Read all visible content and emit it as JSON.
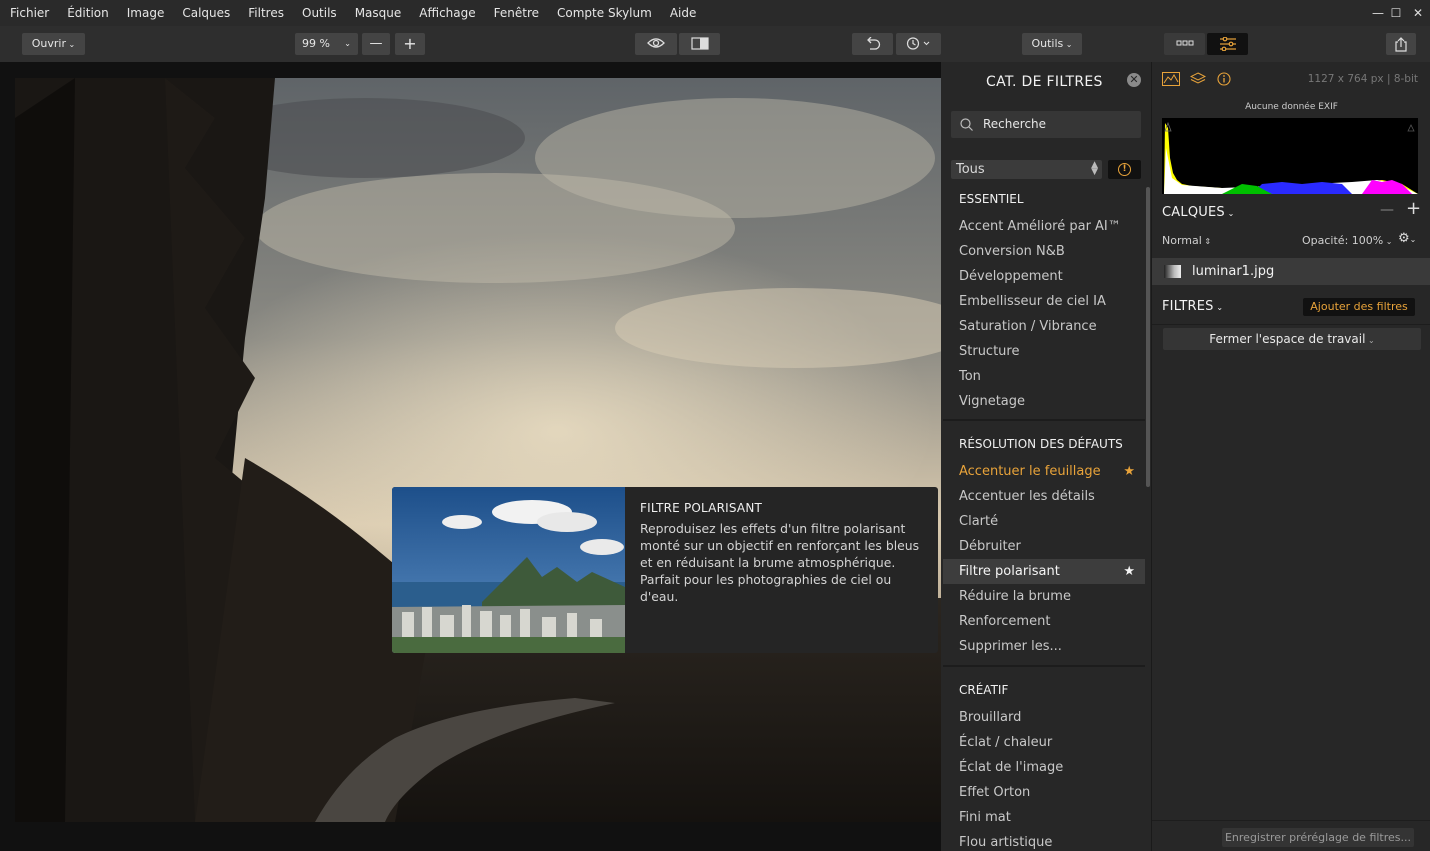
{
  "menubar": {
    "items": [
      "Fichier",
      "Édition",
      "Image",
      "Calques",
      "Filtres",
      "Outils",
      "Masque",
      "Affichage",
      "Fenêtre",
      "Compte Skylum",
      "Aide"
    ]
  },
  "window_controls": {
    "minimize": "—",
    "maximize": "☐",
    "close": "✕"
  },
  "toolbar": {
    "open_label": "Ouvrir",
    "zoom_value": "99 %",
    "zoom_out": "—",
    "zoom_in": "+",
    "tools_label": "Outils"
  },
  "tooltip": {
    "title": "FILTRE POLARISANT",
    "description": "Reproduisez les effets d'un filtre polarisant monté sur un objectif en renforçant les bleus et en réduisant la brume atmosphérique. Parfait pour les photographies de ciel ou d'eau."
  },
  "filter_panel": {
    "title": "CAT. DE FILTRES",
    "close": "✕",
    "search_placeholder": "Recherche",
    "category": "Tous",
    "sections": [
      {
        "head": "ESSENTIEL",
        "items": [
          "Accent Amélioré par AI™",
          "Conversion N&B",
          "Développement",
          "Embellisseur de ciel IA",
          "Saturation / Vibrance",
          "Structure",
          "Ton",
          "Vignetage"
        ]
      },
      {
        "head": "RÉSOLUTION DES DÉFAUTS",
        "items": [
          "Accentuer le feuillage",
          "Accentuer les détails",
          "Clarté",
          "Débruiter",
          "Filtre polarisant",
          "Réduire la brume",
          "Renforcement",
          "Supprimer les..."
        ]
      },
      {
        "head": "CRÉATIF",
        "items": [
          "Brouillard",
          "Éclat / chaleur",
          "Éclat de l'image",
          "Effet Orton",
          "Fini mat",
          "Flou artistique"
        ]
      }
    ],
    "star": "★",
    "favorite_item": "Accentuer le feuillage",
    "selected_item": "Filtre polarisant"
  },
  "right_panel": {
    "image_info": "1127 x 764 px | 8-bit",
    "exif": "Aucune donnée EXIF",
    "layers_title": "CALQUES",
    "blend_mode": "Normal",
    "opacity": "Opacité: 100%",
    "layer_name": "luminar1.jpg",
    "filters_title": "FILTRES",
    "add_filters": "Ajouter des filtres",
    "close_workspace": "Fermer l'espace de travail",
    "save_preset": "Enregistrer préréglage de filtres..."
  },
  "colors": {
    "accent": "#e8a33a",
    "panel": "#272727",
    "toolbar": "#2e2e2e"
  }
}
